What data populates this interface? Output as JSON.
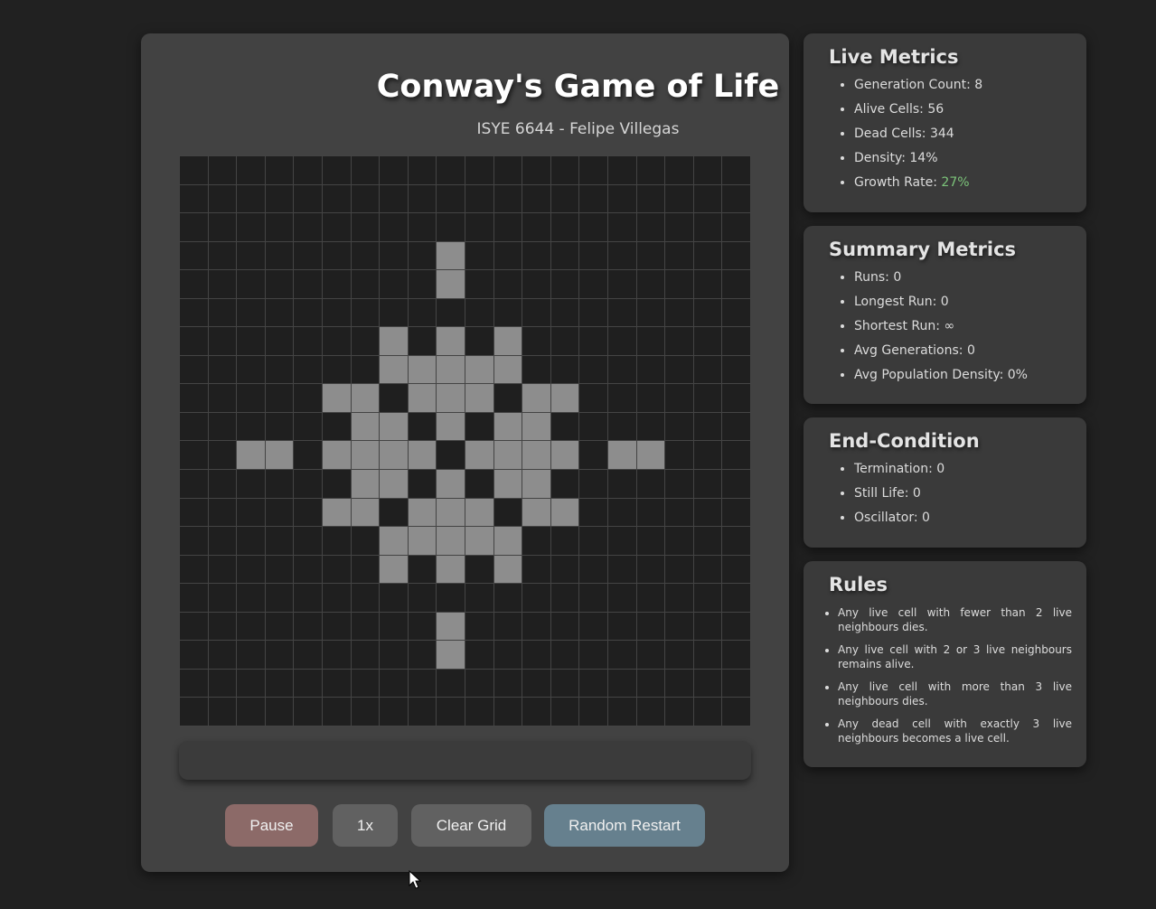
{
  "main": {
    "title": "Conway's Game of Life",
    "subtitle": "ISYE 6644 - Felipe Villegas"
  },
  "grid": {
    "rows": 20,
    "cols": 20,
    "alive_color": "#8d8d8d",
    "dead_color": "#1f1f1f",
    "alive_cells": [
      [
        3,
        9
      ],
      [
        4,
        9
      ],
      [
        6,
        7
      ],
      [
        6,
        9
      ],
      [
        6,
        11
      ],
      [
        7,
        7
      ],
      [
        7,
        8
      ],
      [
        7,
        9
      ],
      [
        7,
        10
      ],
      [
        7,
        11
      ],
      [
        8,
        5
      ],
      [
        8,
        6
      ],
      [
        8,
        8
      ],
      [
        8,
        9
      ],
      [
        8,
        10
      ],
      [
        8,
        12
      ],
      [
        8,
        13
      ],
      [
        9,
        6
      ],
      [
        9,
        7
      ],
      [
        9,
        9
      ],
      [
        9,
        11
      ],
      [
        9,
        12
      ],
      [
        10,
        2
      ],
      [
        10,
        3
      ],
      [
        10,
        5
      ],
      [
        10,
        6
      ],
      [
        10,
        7
      ],
      [
        10,
        8
      ],
      [
        10,
        10
      ],
      [
        10,
        11
      ],
      [
        10,
        12
      ],
      [
        10,
        13
      ],
      [
        10,
        15
      ],
      [
        10,
        16
      ],
      [
        11,
        6
      ],
      [
        11,
        7
      ],
      [
        11,
        9
      ],
      [
        11,
        11
      ],
      [
        11,
        12
      ],
      [
        12,
        5
      ],
      [
        12,
        6
      ],
      [
        12,
        8
      ],
      [
        12,
        9
      ],
      [
        12,
        10
      ],
      [
        12,
        12
      ],
      [
        12,
        13
      ],
      [
        13,
        7
      ],
      [
        13,
        8
      ],
      [
        13,
        9
      ],
      [
        13,
        10
      ],
      [
        13,
        11
      ],
      [
        14,
        7
      ],
      [
        14,
        9
      ],
      [
        14,
        11
      ],
      [
        16,
        9
      ],
      [
        17,
        9
      ]
    ]
  },
  "controls": {
    "pause": "Pause",
    "speed": "1x",
    "clear": "Clear Grid",
    "restart": "Random Restart"
  },
  "live_metrics": {
    "title": "Live Metrics",
    "generation_label": "Generation Count: ",
    "generation_value": "8",
    "alive_label": "Alive Cells: ",
    "alive_value": "56",
    "dead_label": "Dead Cells: ",
    "dead_value": "344",
    "density_label": "Density: ",
    "density_value": "14%",
    "growth_label": "Growth Rate: ",
    "growth_value": "27%",
    "growth_color": "#7cc47a"
  },
  "summary_metrics": {
    "title": "Summary Metrics",
    "runs_label": "Runs: ",
    "runs_value": "0",
    "longest_label": "Longest Run: ",
    "longest_value": "0",
    "shortest_label": "Shortest Run: ",
    "shortest_value": "∞",
    "avg_gen_label": "Avg Generations: ",
    "avg_gen_value": "0",
    "avg_density_label": "Avg Population Density: ",
    "avg_density_value": "0%"
  },
  "end_condition": {
    "title": "End-Condition",
    "termination_label": "Termination: ",
    "termination_value": "0",
    "still_life_label": "Still Life: ",
    "still_life_value": "0",
    "oscillator_label": "Oscillator: ",
    "oscillator_value": "0"
  },
  "rules": {
    "title": "Rules",
    "items": [
      "Any live cell with fewer than 2 live neighbours dies.",
      "Any live cell with 2 or 3 live neighbours remains alive.",
      "Any live cell with more than 3 live neighbours dies.",
      "Any dead cell with exactly 3 live neighbours becomes a live cell."
    ]
  }
}
